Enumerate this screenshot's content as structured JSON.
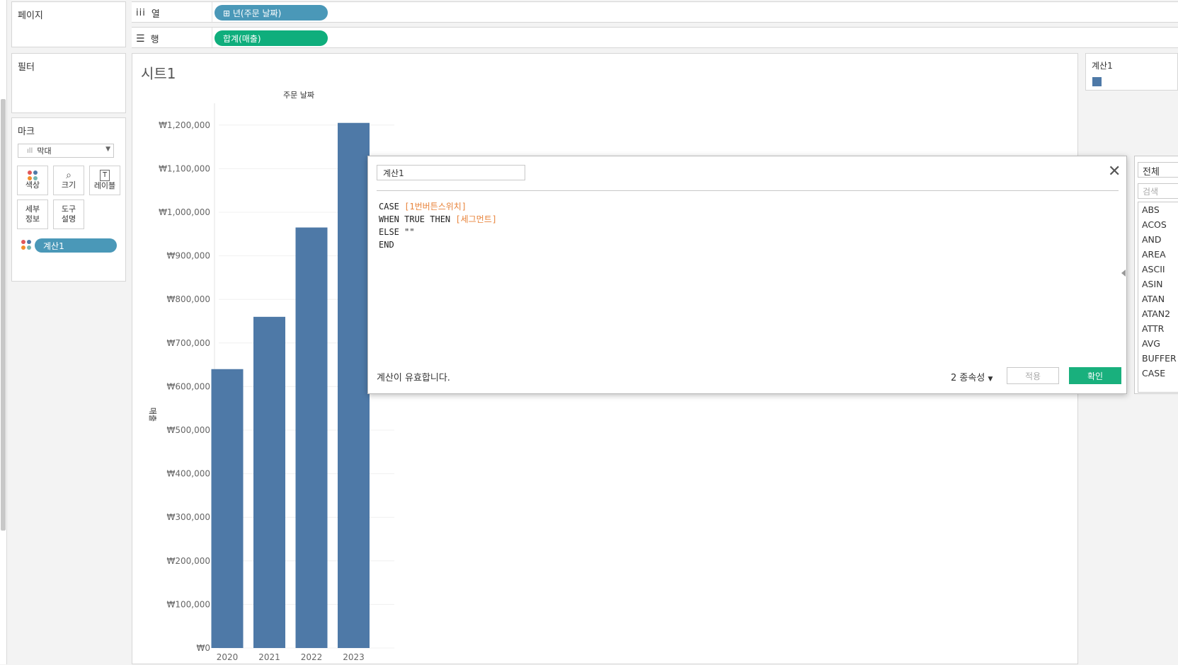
{
  "shelves": {
    "pages_title": "페이지",
    "columns_label": "열",
    "columns_pill": "⊞ 년(주문 날짜)",
    "rows_label": "행",
    "rows_pill": "합계(매출)",
    "columns_pill_color": "#4a98b8",
    "rows_pill_color": "#0fae7c"
  },
  "filters_title": "필터",
  "marks": {
    "title": "마크",
    "type": "막대",
    "buttons": [
      {
        "label": "색상",
        "icon": "color-icon"
      },
      {
        "label": "크기",
        "icon": "size-icon"
      },
      {
        "label": "레이블",
        "icon": "label-icon"
      },
      {
        "label": "세부\n정보",
        "icon": "detail-icon"
      },
      {
        "label": "도구\n설명",
        "icon": "tooltip-icon"
      }
    ],
    "color_pill": "계산1",
    "color_pill_color": "#4a98b8"
  },
  "sheet_title": "시트1",
  "chart_data": {
    "type": "bar",
    "title": "주문 날짜",
    "ylabel": "매출",
    "categories": [
      "2020",
      "2021",
      "2022",
      "2023"
    ],
    "values": [
      640000,
      760000,
      965000,
      1205000
    ],
    "ylim": [
      0,
      1250000
    ],
    "yticks": [
      0,
      100000,
      200000,
      300000,
      400000,
      500000,
      600000,
      700000,
      800000,
      900000,
      1000000,
      1100000,
      1200000
    ],
    "ytick_labels": [
      "₩0",
      "₩100,000",
      "₩200,000",
      "₩300,000",
      "₩400,000",
      "₩500,000",
      "₩600,000",
      "₩700,000",
      "₩800,000",
      "₩900,000",
      "₩1,000,000",
      "₩1,100,000",
      "₩1,200,000"
    ],
    "bar_color": "#4e79a7",
    "grid": true
  },
  "legend": {
    "title": "계산1",
    "swatch_color": "#4e79a7"
  },
  "dialog": {
    "name": "계산1",
    "code_lines": [
      [
        {
          "t": "CASE ",
          "c": "kw"
        },
        {
          "t": "[1번버튼스위치]",
          "c": "fld"
        }
      ],
      [
        {
          "t": "WHEN TRUE THEN ",
          "c": "kw"
        },
        {
          "t": "[세그먼트]",
          "c": "fld"
        }
      ],
      [
        {
          "t": "ELSE \"\"",
          "c": "kw"
        }
      ],
      [
        {
          "t": "END",
          "c": "kw"
        }
      ]
    ],
    "status": "계산이 유효합니다.",
    "dependencies": "2 종속성",
    "apply_label": "적용",
    "ok_label": "확인"
  },
  "functions": {
    "filter": "전체",
    "search_placeholder": "검색",
    "items": [
      "ABS",
      "ACOS",
      "AND",
      "AREA",
      "ASCII",
      "ASIN",
      "ATAN",
      "ATAN2",
      "ATTR",
      "AVG",
      "BUFFER",
      "CASE"
    ]
  }
}
